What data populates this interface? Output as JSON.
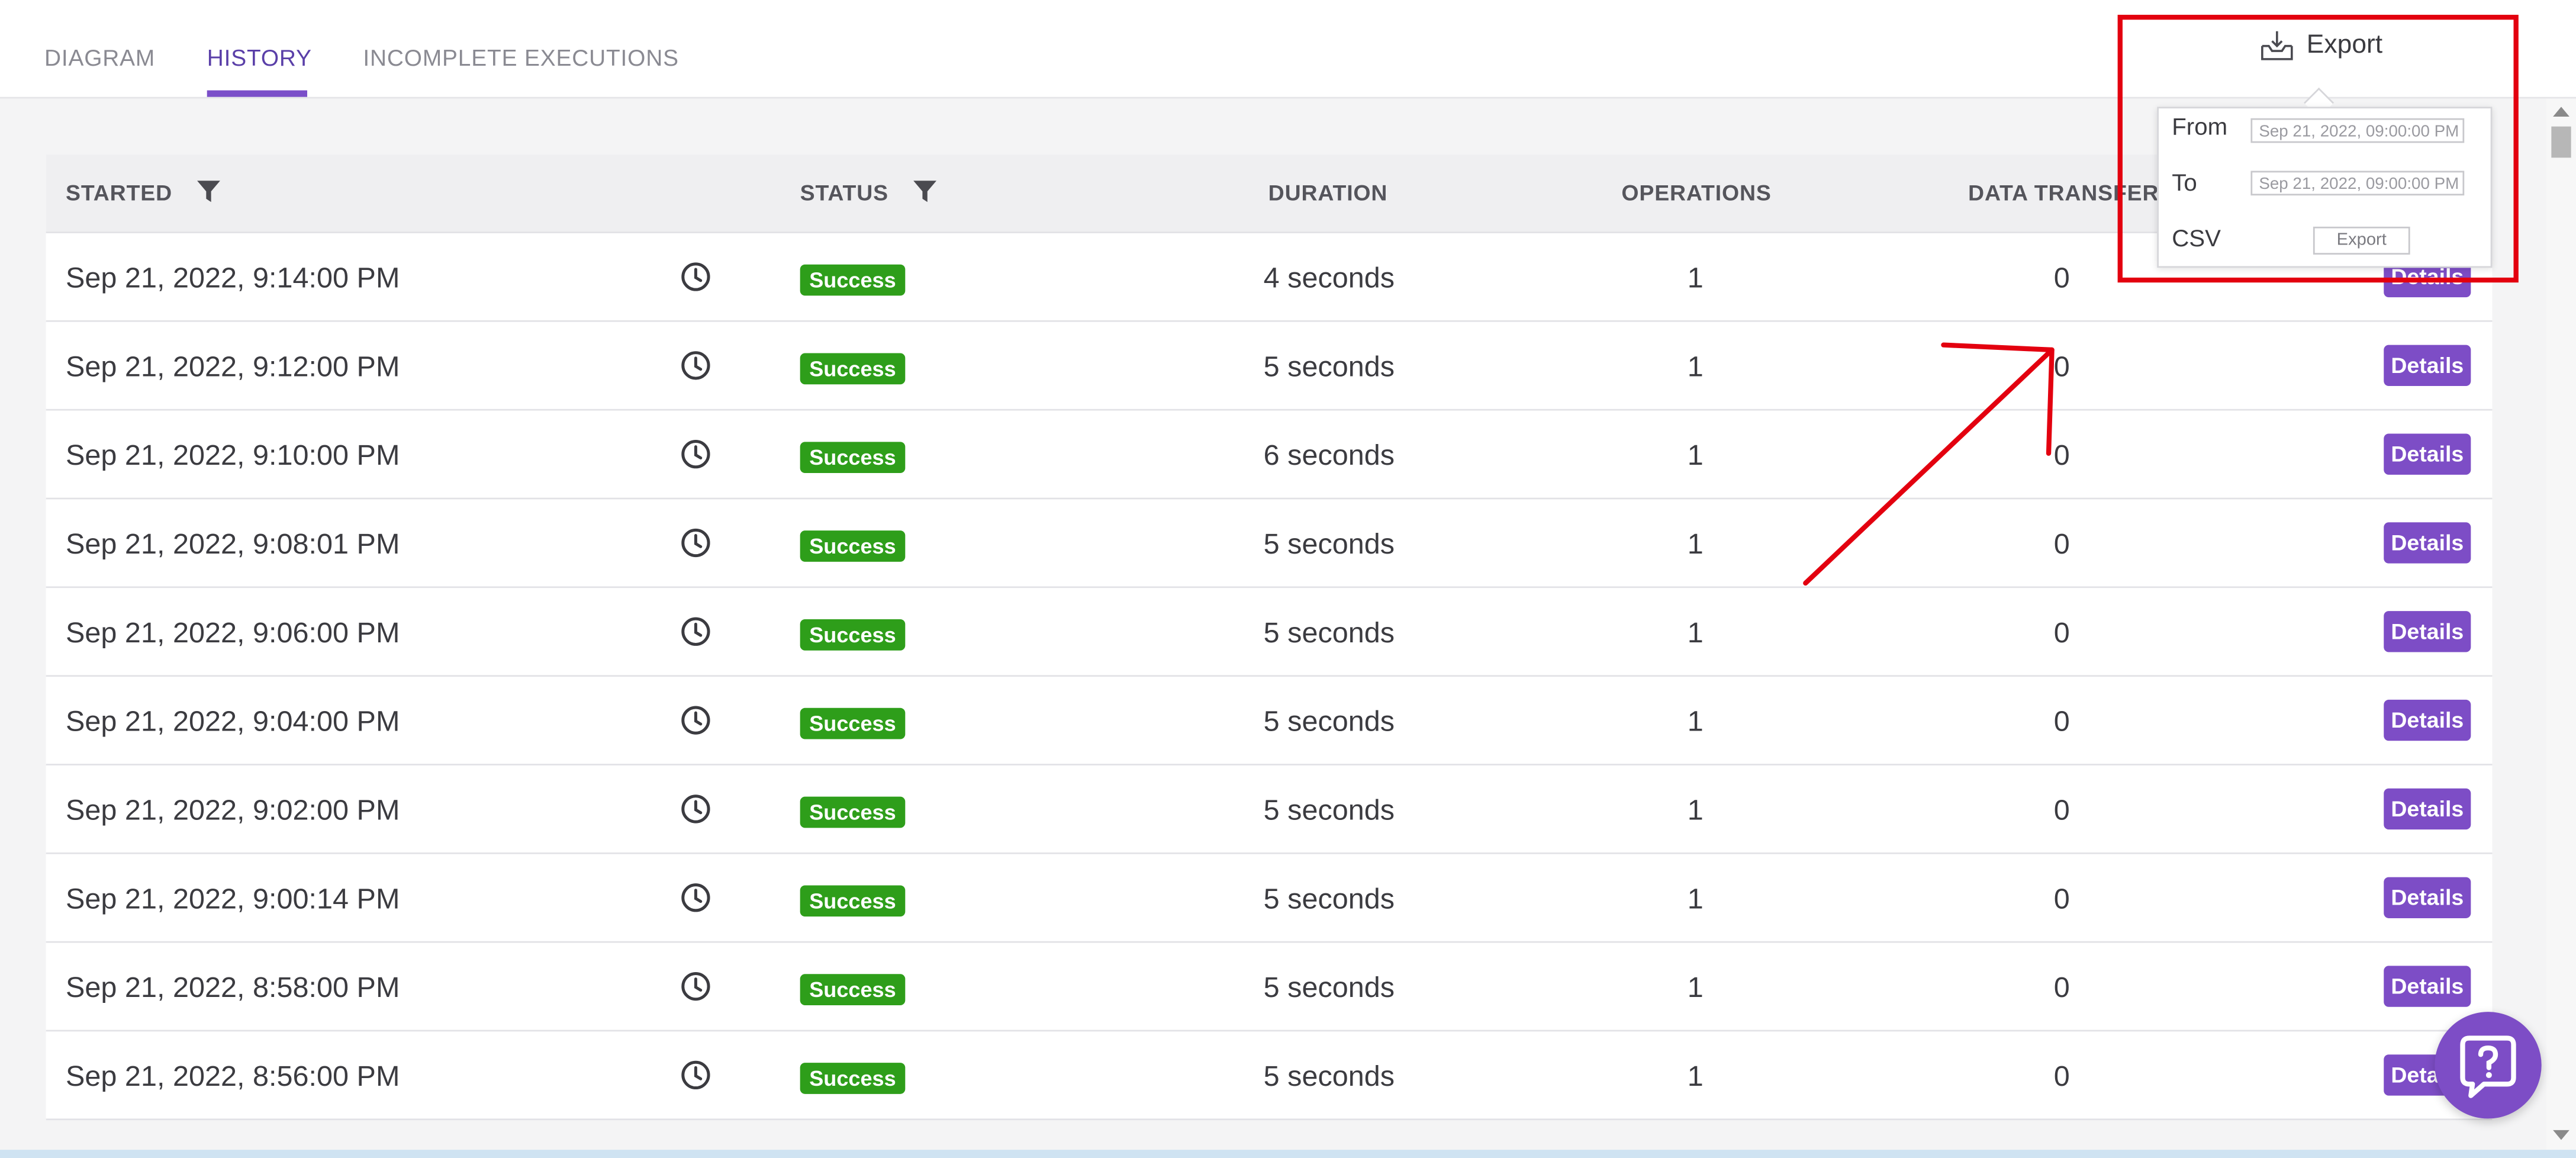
{
  "tabs": [
    {
      "label": "DIAGRAM"
    },
    {
      "label": "HISTORY"
    },
    {
      "label": "INCOMPLETE EXECUTIONS"
    }
  ],
  "active_tab": "HISTORY",
  "table": {
    "headers": {
      "started": "STARTED",
      "status": "STATUS",
      "duration": "DURATION",
      "operations": "OPERATIONS",
      "data_transfer": "DATA TRANSFER"
    },
    "rows": [
      {
        "started": "Sep 21, 2022, 9:14:00 PM",
        "status": "Success",
        "duration": "4 seconds",
        "operations": "1",
        "data_transfer": "0",
        "action": "Details"
      },
      {
        "started": "Sep 21, 2022, 9:12:00 PM",
        "status": "Success",
        "duration": "5 seconds",
        "operations": "1",
        "data_transfer": "0",
        "action": "Details"
      },
      {
        "started": "Sep 21, 2022, 9:10:00 PM",
        "status": "Success",
        "duration": "6 seconds",
        "operations": "1",
        "data_transfer": "0",
        "action": "Details"
      },
      {
        "started": "Sep 21, 2022, 9:08:01 PM",
        "status": "Success",
        "duration": "5 seconds",
        "operations": "1",
        "data_transfer": "0",
        "action": "Details"
      },
      {
        "started": "Sep 21, 2022, 9:06:00 PM",
        "status": "Success",
        "duration": "5 seconds",
        "operations": "1",
        "data_transfer": "0",
        "action": "Details"
      },
      {
        "started": "Sep 21, 2022, 9:04:00 PM",
        "status": "Success",
        "duration": "5 seconds",
        "operations": "1",
        "data_transfer": "0",
        "action": "Details"
      },
      {
        "started": "Sep 21, 2022, 9:02:00 PM",
        "status": "Success",
        "duration": "5 seconds",
        "operations": "1",
        "data_transfer": "0",
        "action": "Details"
      },
      {
        "started": "Sep 21, 2022, 9:00:14 PM",
        "status": "Success",
        "duration": "5 seconds",
        "operations": "1",
        "data_transfer": "0",
        "action": "Details"
      },
      {
        "started": "Sep 21, 2022, 8:58:00 PM",
        "status": "Success",
        "duration": "5 seconds",
        "operations": "1",
        "data_transfer": "0",
        "action": "Details"
      },
      {
        "started": "Sep 21, 2022, 8:56:00 PM",
        "status": "Success",
        "duration": "5 seconds",
        "operations": "1",
        "data_transfer": "0",
        "action": "Details"
      }
    ]
  },
  "export": {
    "button_label": "Export",
    "from_label": "From",
    "from_value": "Sep 21, 2022, 09:00:00 PM",
    "to_label": "To",
    "to_value": "Sep 21, 2022, 09:00:00 PM",
    "format_label": "CSV",
    "export_action_label": "Export"
  },
  "colors": {
    "accent": "#7b4fc9",
    "success": "#2e9e1a",
    "annotation": "#e3000f"
  }
}
